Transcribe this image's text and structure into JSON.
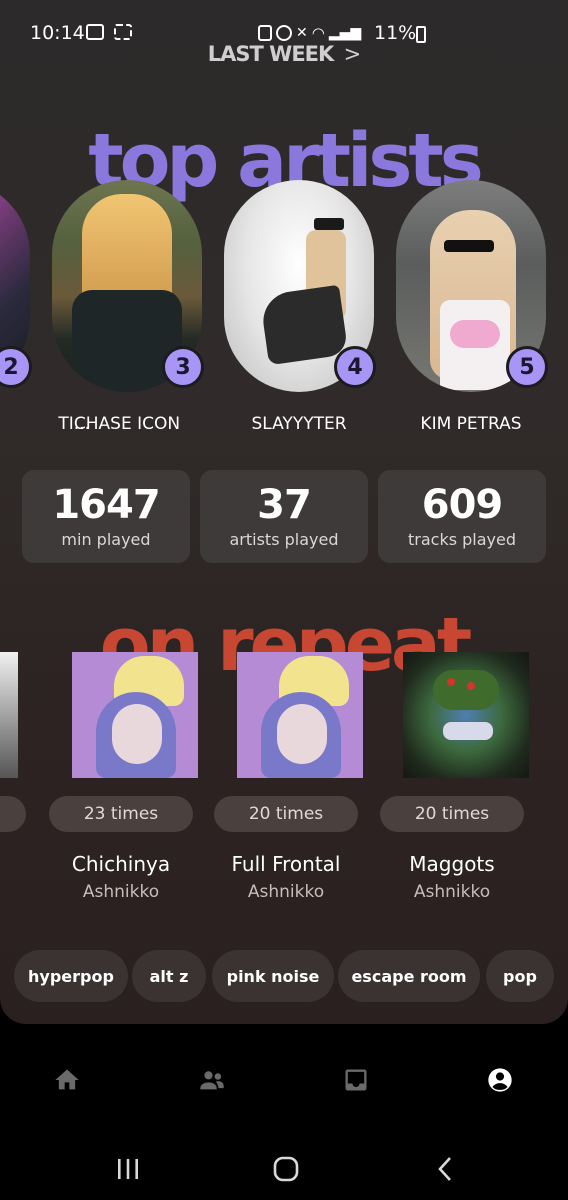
{
  "status_bar": {
    "time": "10:14",
    "battery": "11%"
  },
  "header": {
    "period_label": "LAST WEEK",
    "period_chevron": ">"
  },
  "top_artists": {
    "heading": "top artists",
    "partial_left_label": "TI...",
    "partial_left_rank": "2",
    "items": [
      {
        "rank": "3",
        "name": "CHASE ICON"
      },
      {
        "rank": "4",
        "name": "SLAYYYTER"
      },
      {
        "rank": "5",
        "name": "KIM PETRAS"
      }
    ]
  },
  "stats": [
    {
      "value": "1647",
      "label": "min played"
    },
    {
      "value": "37",
      "label": "artists played"
    },
    {
      "value": "609",
      "label": "tracks played"
    }
  ],
  "on_repeat": {
    "heading": "on repeat",
    "items": [
      {
        "times": "23 times",
        "title": "Chichinya",
        "artist": "Ashnikko"
      },
      {
        "times": "20 times",
        "title": "Full Frontal",
        "artist": "Ashnikko"
      },
      {
        "times": "20 times",
        "title": "Maggots",
        "artist": "Ashnikko"
      }
    ]
  },
  "genres": [
    "hyperpop",
    "alt z",
    "pink noise",
    "escape room",
    "pop"
  ],
  "bottom_nav": [
    "home-icon",
    "friends-icon",
    "inbox-icon",
    "profile-icon"
  ],
  "colors": {
    "accent_purple": "#a796f5",
    "heading_purple": "#8a78dc",
    "heading_red": "#c74732"
  }
}
